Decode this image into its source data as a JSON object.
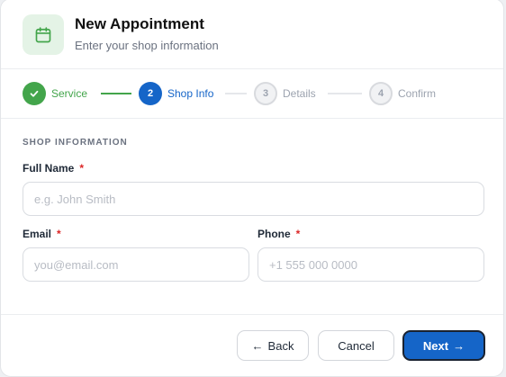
{
  "header": {
    "icon": "calendar-icon",
    "title": "New Appointment",
    "subtitle": "Enter your shop information"
  },
  "stepper": {
    "steps": [
      {
        "number": "1",
        "label": "Service",
        "status": "completed",
        "icon": "check-icon"
      },
      {
        "number": "2",
        "label": "Shop Info",
        "status": "active"
      },
      {
        "number": "3",
        "label": "Details",
        "status": "upcoming"
      },
      {
        "number": "4",
        "label": "Confirm",
        "status": "upcoming"
      }
    ]
  },
  "form": {
    "section_title": "SHOP INFORMATION",
    "required_marker": "*",
    "full_name": {
      "label": "Full Name",
      "value": "",
      "placeholder": "e.g. John Smith"
    },
    "email": {
      "label": "Email",
      "value": "",
      "placeholder": "you@email.com"
    },
    "phone": {
      "label": "Phone",
      "value": "",
      "placeholder": "+1 555 000 0000"
    }
  },
  "footer": {
    "back_label": "Back",
    "back_arrow": "←",
    "cancel_label": "Cancel",
    "next_label": "Next",
    "next_arrow": "→"
  },
  "colors": {
    "completed": "#43a54b",
    "active": "#1565c8",
    "upcoming": "#9ca3af",
    "required": "#dc2626",
    "icon_background": "#e4f3e6"
  }
}
